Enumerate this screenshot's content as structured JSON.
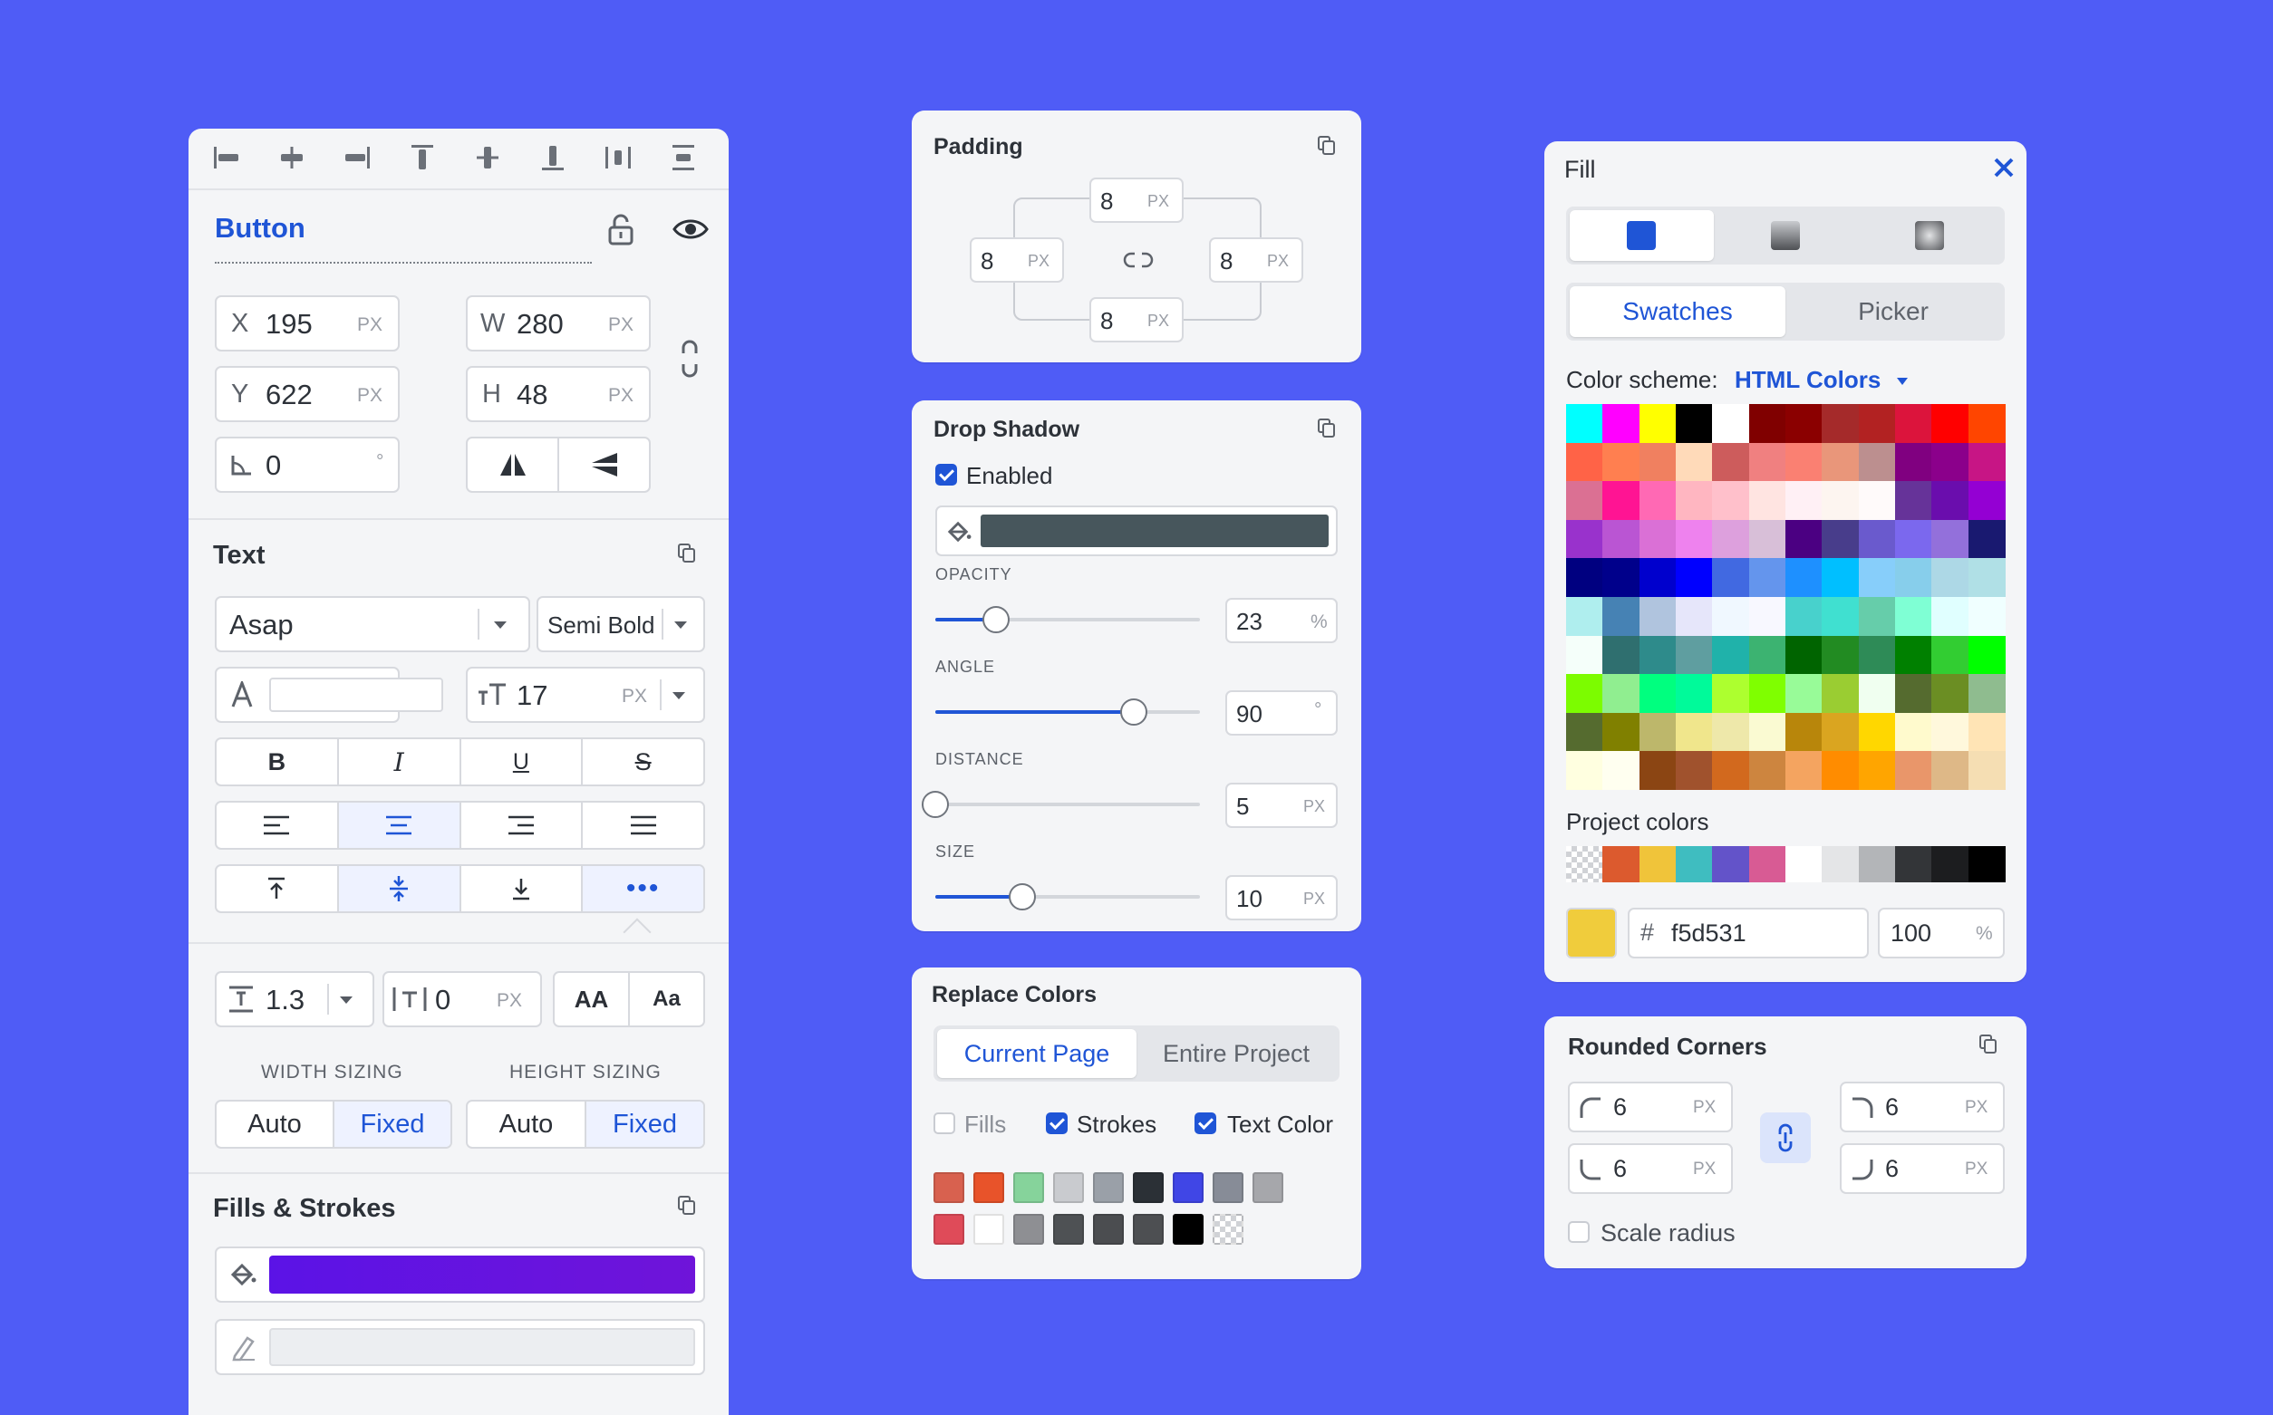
{
  "colors": {
    "background": "#4f5cf6",
    "accent": "#1f55d6"
  },
  "layer": {
    "name": "Button",
    "x": "195",
    "y": "622",
    "w": "280",
    "h": "48",
    "rotation": "0",
    "unit_px": "PX",
    "unit_deg": "°",
    "x_label": "X",
    "y_label": "Y",
    "w_label": "W",
    "h_label": "H"
  },
  "text": {
    "title": "Text",
    "font_family": "Asap",
    "font_weight": "Semi Bold",
    "font_size": "17",
    "line_height": "1.3",
    "letter_spacing": "0",
    "case_upper": "AA",
    "case_title": "Aa",
    "width_sizing_label": "WIDTH SIZING",
    "height_sizing_label": "HEIGHT SIZING",
    "auto": "Auto",
    "fixed": "Fixed"
  },
  "fills_strokes": {
    "title": "Fills & Strokes",
    "fill_color": "#5b13e6"
  },
  "padding": {
    "title": "Padding",
    "top": "8",
    "right": "8",
    "bottom": "8",
    "left": "8"
  },
  "drop_shadow": {
    "title": "Drop Shadow",
    "enabled_label": "Enabled",
    "color": "#47565c",
    "opacity_label": "OPACITY",
    "opacity": "23",
    "opacity_unit": "%",
    "opacity_level": 0.23,
    "angle_label": "ANGLE",
    "angle": "90",
    "angle_level": 0.75,
    "distance_label": "DISTANCE",
    "distance": "5",
    "distance_level": 0.0,
    "size_label": "SIZE",
    "size": "10",
    "size_level": 0.33
  },
  "replace_colors": {
    "title": "Replace Colors",
    "tab_current": "Current Page",
    "tab_project": "Entire Project",
    "fills": "Fills",
    "strokes": "Strokes",
    "text_color": "Text Color",
    "row1": [
      "#d8614f",
      "#e8532a",
      "#86d39b",
      "#c9cbcf",
      "#9aa0a8",
      "#2b3036",
      "#4046e6",
      "#878c97",
      "#a6a7ab"
    ],
    "row2": [
      "#df4b59",
      "#ffffff",
      "#8e8f93",
      "#4e5154",
      "#4b4d50",
      "#4d4f52",
      "#000000",
      "checker"
    ]
  },
  "fill_panel": {
    "title": "Fill",
    "tab_swatches": "Swatches",
    "tab_picker": "Picker",
    "scheme_label": "Color scheme:",
    "scheme_value": "HTML Colors",
    "project_colors_label": "Project colors",
    "hex_prefix": "#",
    "hex": "f5d531",
    "current_color": "#f0cc3c",
    "alpha": "100",
    "alpha_unit": "%",
    "project_colors": [
      "checker",
      "#dc5a2e",
      "#f0c43a",
      "#3fbdc0",
      "#6353c9",
      "#d85b94",
      "#ffffff",
      "#e4e5e7",
      "#b3b5b8",
      "#333538",
      "#1c1d1f",
      "#000000"
    ],
    "grid": [
      [
        "#00ffff",
        "#ff00ff",
        "#ffff00",
        "#000000",
        "#ffffff",
        "#800000",
        "#8b0000",
        "#a52a2a",
        "#b22222",
        "#dc143c",
        "#ff0000",
        "#ff4500"
      ],
      [
        "#ff6347",
        "#ff7f50",
        "#f08060",
        "#ffdab9",
        "#cd5c5c",
        "#f08080",
        "#fa8072",
        "#e9967a",
        "#bc8f8f",
        "#800080",
        "#8b008b",
        "#c71585"
      ],
      [
        "#db7093",
        "#ff1493",
        "#ff69b4",
        "#ffb6c1",
        "#ffc0cb",
        "#ffe4e1",
        "#fff0f5",
        "#fdf5f0",
        "#fffafa",
        "#663399",
        "#6a0dad",
        "#9400d3"
      ],
      [
        "#9932cc",
        "#ba55d3",
        "#da70d6",
        "#ee82ee",
        "#dda0dd",
        "#d8bfd8",
        "#4b0082",
        "#483d8b",
        "#6a5acd",
        "#7b68ee",
        "#9370db",
        "#191970"
      ],
      [
        "#000080",
        "#00008b",
        "#0000cd",
        "#0000ff",
        "#4169e1",
        "#6495ed",
        "#1e90ff",
        "#00bfff",
        "#87cefa",
        "#87ceeb",
        "#add8e6",
        "#b0e0e6"
      ],
      [
        "#afeeee",
        "#4682b4",
        "#b0c4de",
        "#e6e6fa",
        "#f0f8ff",
        "#f8f8ff",
        "#48d1cc",
        "#40e0d0",
        "#66cdaa",
        "#7fffd4",
        "#e0ffff",
        "#f0ffff"
      ],
      [
        "#f5fffa",
        "#2f6f6f",
        "#2e8b8b",
        "#5f9ea0",
        "#20b2aa",
        "#3cb371",
        "#006400",
        "#228b22",
        "#2e8b57",
        "#008000",
        "#32cd32",
        "#00ff00"
      ],
      [
        "#7cfc00",
        "#90ee90",
        "#00ff7f",
        "#00fa9a",
        "#adff2f",
        "#7fff00",
        "#98fb98",
        "#9acd32",
        "#f0fff0",
        "#556b2f",
        "#6b8e23",
        "#8fbc8f"
      ],
      [
        "#556b2f",
        "#808000",
        "#bdb76b",
        "#f0e68c",
        "#eee8aa",
        "#fafad2",
        "#b8860b",
        "#daa520",
        "#ffd700",
        "#fffacd",
        "#fff8dc",
        "#ffe4b5"
      ],
      [
        "#ffffe0",
        "#fffff0",
        "#8b4513",
        "#a0522d",
        "#d2691e",
        "#cd853f",
        "#f4a460",
        "#ff8c00",
        "#ffa500",
        "#e9966a",
        "#deb887",
        "#f5deb3"
      ]
    ]
  },
  "rounded_corners": {
    "title": "Rounded Corners",
    "tl": "6",
    "tr": "6",
    "bl": "6",
    "br": "6",
    "scale_radius": "Scale radius"
  }
}
